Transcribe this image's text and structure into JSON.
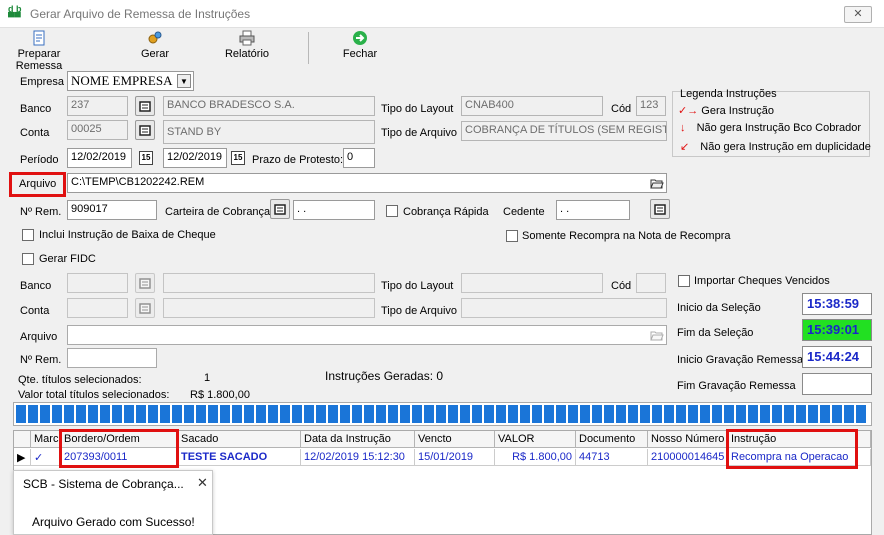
{
  "window": {
    "title": "Gerar Arquivo de Remessa de Instruções",
    "close_glyph": "✕",
    "app_icon": "db-app-icon"
  },
  "toolbar": {
    "preparar_label": "Preparar Remessa",
    "gerar_label": "Gerar",
    "relatorio_label": "Relatório",
    "fechar_label": "Fechar"
  },
  "form": {
    "empresa_label": "Empresa",
    "empresa_value": "NOME EMPRESA",
    "banco_label": "Banco",
    "banco_code": "237",
    "banco_name": "BANCO BRADESCO S.A.",
    "tipo_layout_label": "Tipo do Layout",
    "tipo_layout_value": "CNAB400",
    "cod_label": "Cód",
    "cod_value": "123",
    "conta_label": "Conta",
    "conta_code": "00025",
    "conta_name": "STAND BY",
    "tipo_arquivo_label": "Tipo de Arquivo",
    "tipo_arquivo_value": "COBRANÇA DE TÍTULOS (SEM REGISTF",
    "periodo_label": "Período",
    "periodo_from": "12/02/2019",
    "periodo_to": "12/02/2019",
    "prazo_label": "Prazo de Protesto:",
    "prazo_value": "0",
    "arquivo_label": "Arquivo",
    "arquivo_value": "C:\\TEMP\\CB1202242.REM",
    "nrem_label": "Nº Rem.",
    "nrem_value": "909017",
    "carteira_label": "Carteira de Cobrança",
    "carteira_value": ". .",
    "cobranca_rapida_label": "Cobrança Rápida",
    "cedente_label": "Cedente",
    "cedente_value": ". .",
    "inclui_baixa_label": "Inclui Instrução de Baixa de Cheque",
    "somente_recompra_label": "Somente Recompra na Nota de Recompra",
    "gerar_fidc_label": "Gerar FIDC"
  },
  "legend": {
    "title": "Legenda Instruções",
    "items": [
      {
        "icon": "✓→",
        "label": "Gera Instrução"
      },
      {
        "icon": "↓",
        "label": "Não gera Instrução Bco Cobrador"
      },
      {
        "icon": "↙",
        "label": "Não gera Instrução em duplicidade"
      }
    ]
  },
  "fidc": {
    "banco_label": "Banco",
    "tipo_layout_label": "Tipo do Layout",
    "cod_label": "Cód",
    "conta_label": "Conta",
    "tipo_arquivo_label": "Tipo de Arquivo",
    "arquivo_label": "Arquivo",
    "nrem_label": "Nº Rem.",
    "importar_label": "Importar Cheques Vencidos"
  },
  "times": {
    "inicio_selecao_label": "Inicio da Seleção",
    "inicio_selecao_value": "15:38:59",
    "fim_selecao_label": "Fim da Seleção",
    "fim_selecao_value": "15:39:01",
    "inicio_gravacao_label": "Inicio Gravação Remessa",
    "inicio_gravacao_value": "15:44:24",
    "fim_gravacao_label": "Fim Gravação Remessa",
    "fim_gravacao_value": ""
  },
  "summary": {
    "qte_label": "Qte. títulos selecionados:",
    "qte_value": "1",
    "valor_label": "Valor total títulos selecionados:",
    "valor_value": "R$ 1.800,00",
    "instrucoes_label": "Instruções Geradas: 0"
  },
  "progress": {
    "fraction": 1.0,
    "color": "#1a75d8"
  },
  "table": {
    "columns": [
      "Marca",
      "Bordero/Ordem",
      "Sacado",
      "Data da Instrução",
      "Vencto",
      "VALOR",
      "Documento",
      "Nosso Número",
      "Instrução"
    ],
    "rows": [
      {
        "indicator": "▶",
        "marca": "✓",
        "bordero": "207393/0011",
        "sacado": "TESTE SACADO",
        "data": "12/02/2019 15:12:30",
        "vencto": "15/01/2019",
        "valor": "R$ 1.800,00",
        "documento": "44713",
        "nosso_numero": "210000014645",
        "instrucao": "Recompra na Operacao"
      }
    ]
  },
  "toast": {
    "title": "SCB - Sistema de Cobrança...",
    "close_glyph": "✕",
    "message": "Arquivo Gerado com Sucesso!"
  },
  "colors": {
    "highlight": "#e01010",
    "time_text": "#1a28c8",
    "fim_selecao_bg": "#22e022",
    "progress": "#1a75d8"
  }
}
